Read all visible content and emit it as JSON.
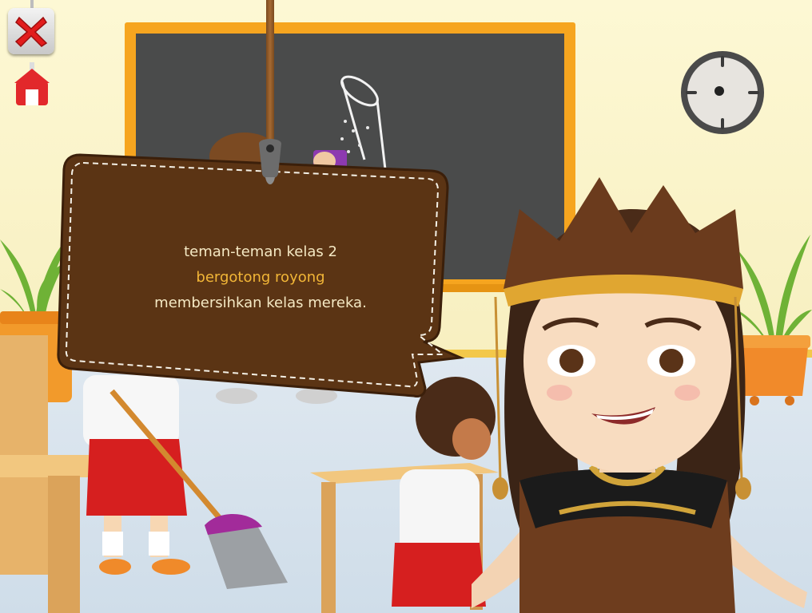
{
  "controls": {
    "close_icon": "close-x-icon",
    "home_icon": "home-icon"
  },
  "story": {
    "line1": "teman-teman kelas 2",
    "line2": "bergotong royong",
    "line3": "membersihkan kelas mereka."
  },
  "colors": {
    "story_text": "#f5e9c4",
    "story_highlight": "#f2b637",
    "bubble_fill": "#5b3414",
    "chalkboard": "#4a4b4b",
    "board_frame": "#f6a51f",
    "close_red": "#e21c1c"
  }
}
